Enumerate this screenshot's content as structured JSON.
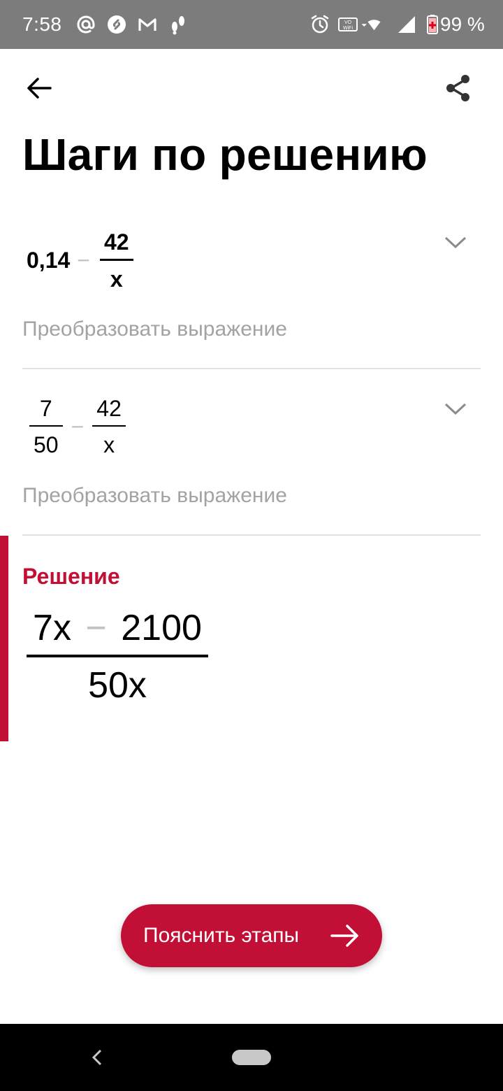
{
  "status_bar": {
    "time": "7:58",
    "battery": "99 %",
    "left_icons": [
      "at-sign-icon",
      "shazam-icon",
      "gmail-icon",
      "footprints-icon"
    ],
    "right_icons": [
      "alarm-icon",
      "vowifi-icon",
      "wifi-icon",
      "signal-icon",
      "battery-icon"
    ]
  },
  "header": {
    "title": "Шаги по решению"
  },
  "steps": [
    {
      "expression": {
        "lhs": "0,14",
        "op": "−",
        "num": "42",
        "den": "x"
      },
      "caption": "Преобразовать выражение"
    },
    {
      "expression": {
        "lhs_num": "7",
        "lhs_den": "50",
        "op": "−",
        "num": "42",
        "den": "x"
      },
      "caption": "Преобразовать выражение"
    }
  ],
  "solution": {
    "label": "Решение",
    "num_a": "7x",
    "op": "−",
    "num_b": "2100",
    "den": "50x"
  },
  "explain_button": {
    "label": "Пояснить этапы"
  },
  "colors": {
    "accent": "#c10f35",
    "status_bar": "#7c7c7c",
    "caption": "#a3a3a3"
  }
}
